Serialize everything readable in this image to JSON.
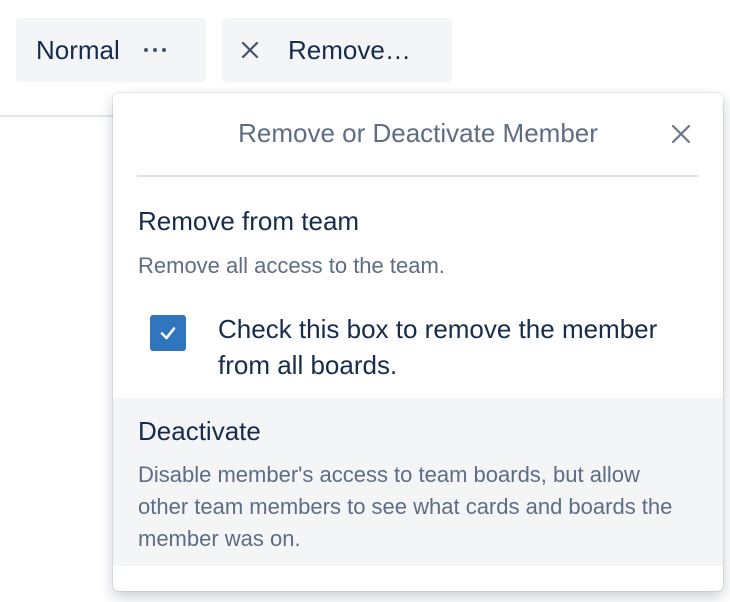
{
  "toolbar": {
    "role_label": "Normal",
    "remove_label": "Remove…"
  },
  "popover": {
    "title": "Remove or Deactivate Member",
    "remove_section": {
      "title": "Remove from team",
      "description": "Remove all access to the team.",
      "checkbox_label": "Check this box to remove the member from all boards.",
      "checkbox_checked": true
    },
    "deactivate_section": {
      "title": "Deactivate",
      "description": "Disable member's access to team boards, but allow other team members to see what cards and boards the member was on."
    }
  },
  "icons": {
    "more": "more-icon",
    "close": "close-icon",
    "check": "check-icon"
  },
  "colors": {
    "checkbox_fill": "#2f76bd",
    "button_bg": "#f4f5f7",
    "text_primary": "#172b4d",
    "text_secondary": "#5e6c84"
  }
}
